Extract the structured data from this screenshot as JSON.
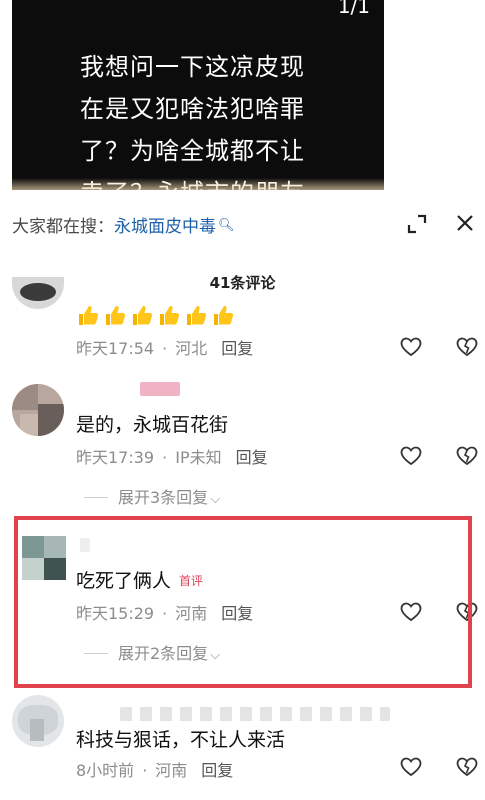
{
  "video": {
    "counter": "1/1",
    "caption": "我想问一下这凉皮现\n在是又犯啥法犯啥罪\n了？为啥全城都不让\n卖了？永城市的朋友"
  },
  "search": {
    "label": "大家都在搜：",
    "query": "永城面皮中毒"
  },
  "comments_header": {
    "count_text": "41条评论"
  },
  "comments": [
    {
      "text": "👍👍👍👍👍👍",
      "time": "昨天17:54",
      "location": "河北",
      "reply_label": "回复"
    },
    {
      "text": "是的，永城百花街",
      "time": "昨天17:39",
      "location": "IP未知",
      "reply_label": "回复",
      "expand_label": "展开3条回复"
    },
    {
      "text": "吃死了俩人",
      "badge": "首评",
      "time": "昨天15:29",
      "location": "河南",
      "reply_label": "回复",
      "expand_label": "展开2条回复"
    },
    {
      "text": "科技与狠话，不让人来活",
      "time": "8小时前",
      "location": "河南",
      "reply_label": "回复"
    }
  ],
  "colors": {
    "accent_link": "#1f5fa8",
    "highlight_border": "#e0434e",
    "badge": "#e0455a"
  }
}
